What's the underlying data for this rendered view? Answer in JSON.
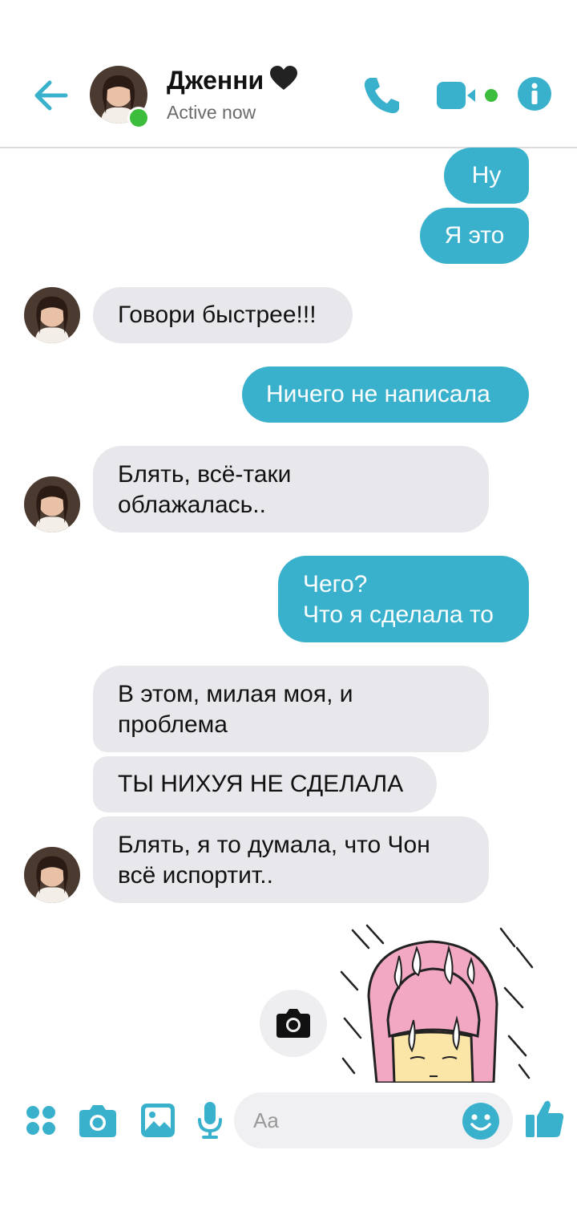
{
  "header": {
    "name": "Дженни",
    "status": "Active now",
    "icons": [
      "back-arrow-icon",
      "black-heart-icon",
      "phone-icon",
      "video-camera-icon",
      "info-icon"
    ]
  },
  "messages": [
    {
      "dir": "out",
      "text": "Ну"
    },
    {
      "dir": "out",
      "text": "Я это"
    },
    {
      "dir": "in",
      "text": "Говори быстрее!!!"
    },
    {
      "dir": "out",
      "text": "Ничего не написала"
    },
    {
      "dir": "in",
      "lines": [
        "Блять, всё-таки",
        "облажалась.."
      ]
    },
    {
      "dir": "out",
      "lines": [
        "Чего?",
        "Что я сделала то"
      ]
    },
    {
      "dir": "in",
      "lines": [
        "В этом, милая моя, и",
        "проблема"
      ]
    },
    {
      "dir": "in",
      "text": "ТЫ НИХУЯ НЕ СДЕЛАЛА"
    },
    {
      "dir": "in",
      "lines": [
        "Блять, я то думала, что Чон",
        "всё испортит.."
      ]
    }
  ],
  "composer": {
    "placeholder": "Aa",
    "icons": [
      "apps-icon",
      "camera-icon",
      "gallery-icon",
      "microphone-icon",
      "emoji-icon",
      "thumbs-up-icon"
    ]
  },
  "colors": {
    "accent": "#3ab1cc",
    "incoming_bubble": "#e8e8ec",
    "online": "#3cbd3c",
    "sticker_hair": "#f2a7c3"
  }
}
